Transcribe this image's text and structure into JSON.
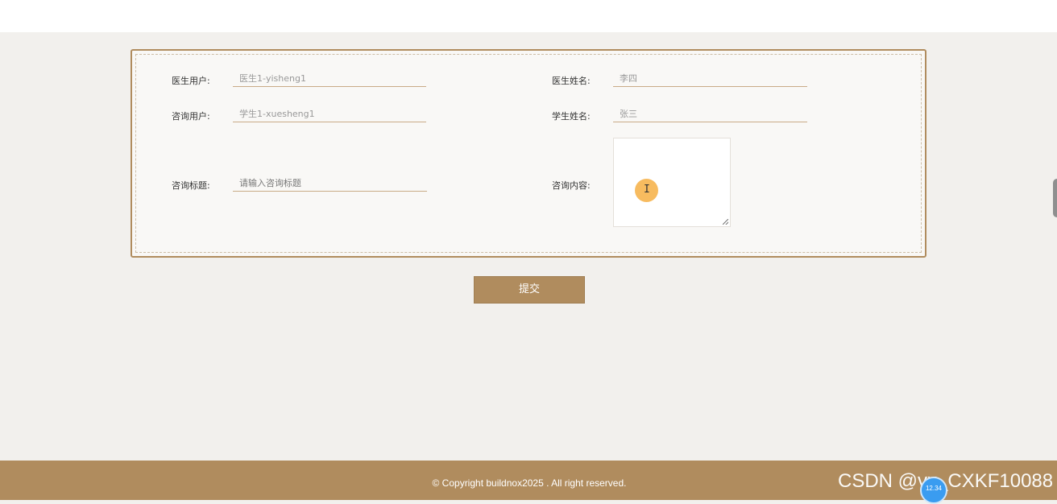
{
  "form": {
    "doctor_user": {
      "label": "医生用户:",
      "value": "医生1-yisheng1"
    },
    "doctor_name": {
      "label": "医生姓名:",
      "value": "李四"
    },
    "consult_user": {
      "label": "咨询用户:",
      "value": "学生1-xuesheng1"
    },
    "student_name": {
      "label": "学生姓名:",
      "value": "张三"
    },
    "consult_title": {
      "label": "咨询标题:",
      "placeholder": "请输入咨询标题"
    },
    "consult_content": {
      "label": "咨询内容:"
    },
    "submit_label": "提交"
  },
  "footer": {
    "copyright": "© Copyright buildnox2025 . All right reserved."
  },
  "overlay": {
    "watermark": "CSDN @vx_CXKF10088",
    "badge": "12.34"
  },
  "colors": {
    "accent": "#b08c5e",
    "page_bg": "#f2f0ed",
    "cursor_highlight": "#f6b44e"
  }
}
